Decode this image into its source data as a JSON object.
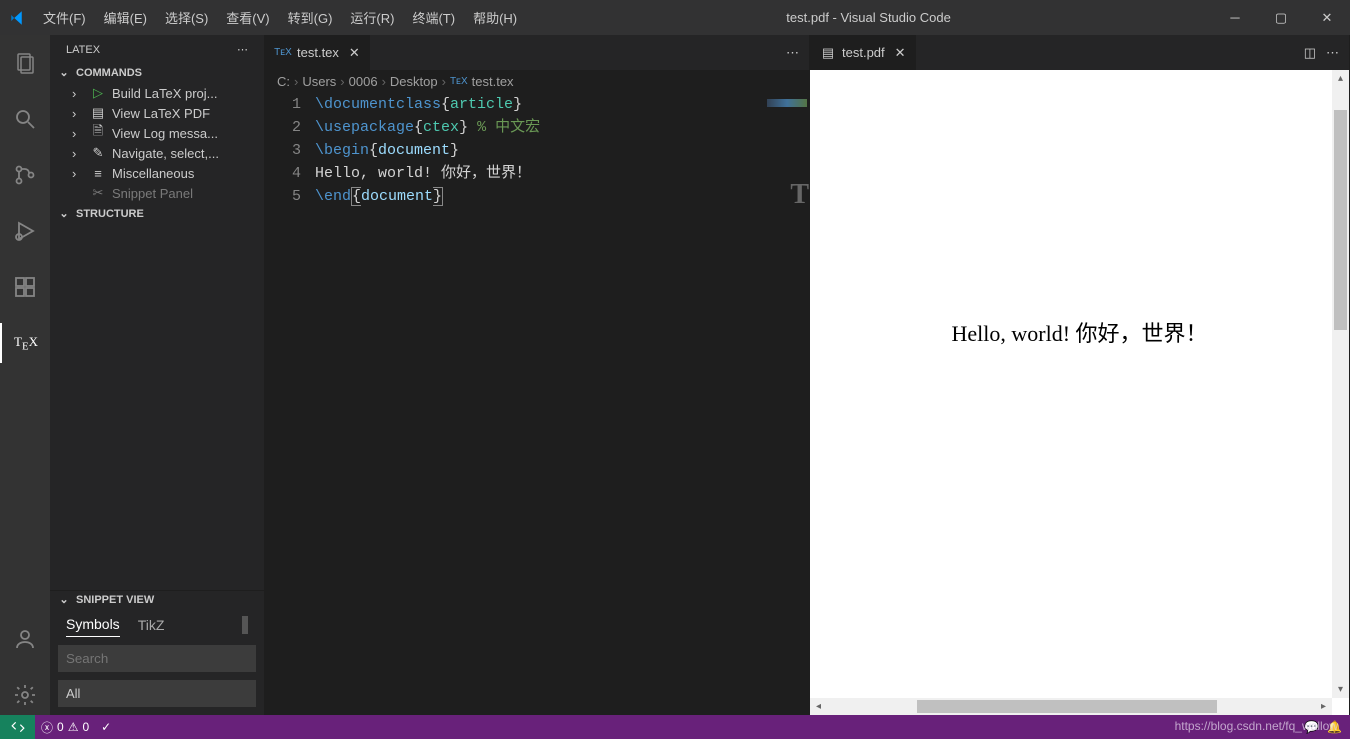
{
  "menubar": [
    "文件(F)",
    "编辑(E)",
    "选择(S)",
    "查看(V)",
    "转到(G)",
    "运行(R)",
    "终端(T)",
    "帮助(H)"
  ],
  "window_title": "test.pdf - Visual Studio Code",
  "sidebar": {
    "title": "LATEX",
    "sections": {
      "commands": {
        "label": "COMMANDS",
        "items": [
          {
            "icon": "play",
            "label": "Build LaTeX proj..."
          },
          {
            "icon": "book",
            "label": "View LaTeX PDF"
          },
          {
            "icon": "file",
            "label": "View Log messa..."
          },
          {
            "icon": "pencil",
            "label": "Navigate, select,..."
          },
          {
            "icon": "list",
            "label": "Miscellaneous"
          }
        ],
        "overflow": "Snippet Panel"
      },
      "structure": {
        "label": "STRUCTURE"
      },
      "snippet": {
        "label": "SNIPPET VIEW",
        "tabs": [
          "Symbols",
          "TikZ"
        ],
        "search_placeholder": "Search",
        "dropdown": "All"
      }
    }
  },
  "editor": {
    "tab_label": "test.tex",
    "breadcrumb": [
      "C:",
      "Users",
      "0006",
      "Desktop",
      "test.tex"
    ],
    "breadcrumb_icon": "tex-file-icon",
    "watermark_glyph": "T"
  },
  "code": {
    "lines": [
      [
        {
          "t": "\\documentclass",
          "c": "tok-cmd"
        },
        {
          "t": "{",
          "c": "tok-brace"
        },
        {
          "t": "article",
          "c": "tok-arg"
        },
        {
          "t": "}",
          "c": "tok-brace"
        }
      ],
      [
        {
          "t": "\\usepackage",
          "c": "tok-cmd"
        },
        {
          "t": "{",
          "c": "tok-brace"
        },
        {
          "t": "ctex",
          "c": "tok-arg"
        },
        {
          "t": "}",
          "c": "tok-brace"
        },
        {
          "t": " ",
          "c": "tok-text"
        },
        {
          "t": "%",
          "c": "tok-pct"
        },
        {
          "t": " 中文宏",
          "c": "tok-comment"
        }
      ],
      [
        {
          "t": "\\begin",
          "c": "tok-cmd"
        },
        {
          "t": "{",
          "c": "tok-brace"
        },
        {
          "t": "document",
          "c": "tok-arg2"
        },
        {
          "t": "}",
          "c": "tok-brace"
        }
      ],
      [
        {
          "t": "Hello, world! 你好，世界！",
          "c": "tok-text"
        }
      ],
      [
        {
          "t": "\\end",
          "c": "tok-cmd"
        },
        {
          "t": "{",
          "c": "tok-brace box-l"
        },
        {
          "t": "document",
          "c": "tok-arg2"
        },
        {
          "t": "}",
          "c": "tok-brace box-r"
        }
      ]
    ]
  },
  "pdf": {
    "tab_label": "test.pdf",
    "rendered_text": "Hello, world! 你好，世界！"
  },
  "statusbar": {
    "errors": "0",
    "warnings": "0",
    "url_watermark": "https://blog.csdn.net/fq_wallow"
  },
  "icons": {
    "tex_prefix": "TᴇX"
  }
}
